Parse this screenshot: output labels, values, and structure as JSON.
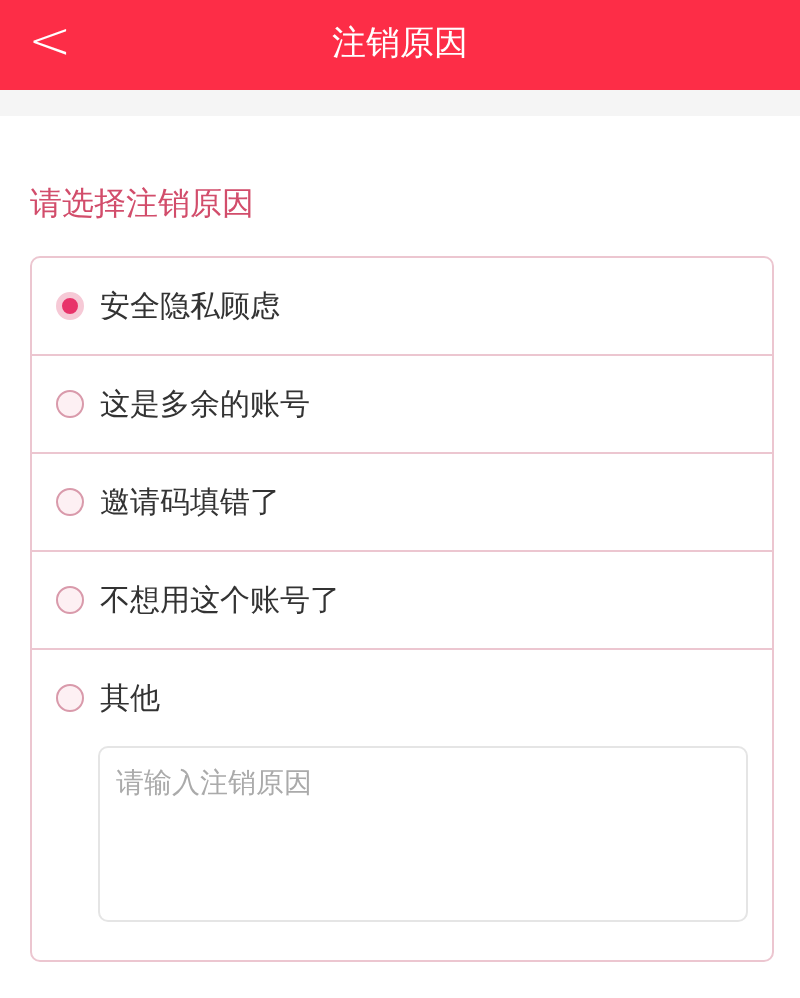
{
  "header": {
    "back": "<",
    "title": "注销原因"
  },
  "section_title": "请选择注销原因",
  "reasons": [
    {
      "label": "安全隐私顾虑",
      "selected": true
    },
    {
      "label": "这是多余的账号",
      "selected": false
    },
    {
      "label": "邀请码填错了",
      "selected": false
    },
    {
      "label": "不想用这个账号了",
      "selected": false
    },
    {
      "label": "其他",
      "selected": false
    }
  ],
  "other_field": {
    "placeholder": "请输入注销原因"
  }
}
